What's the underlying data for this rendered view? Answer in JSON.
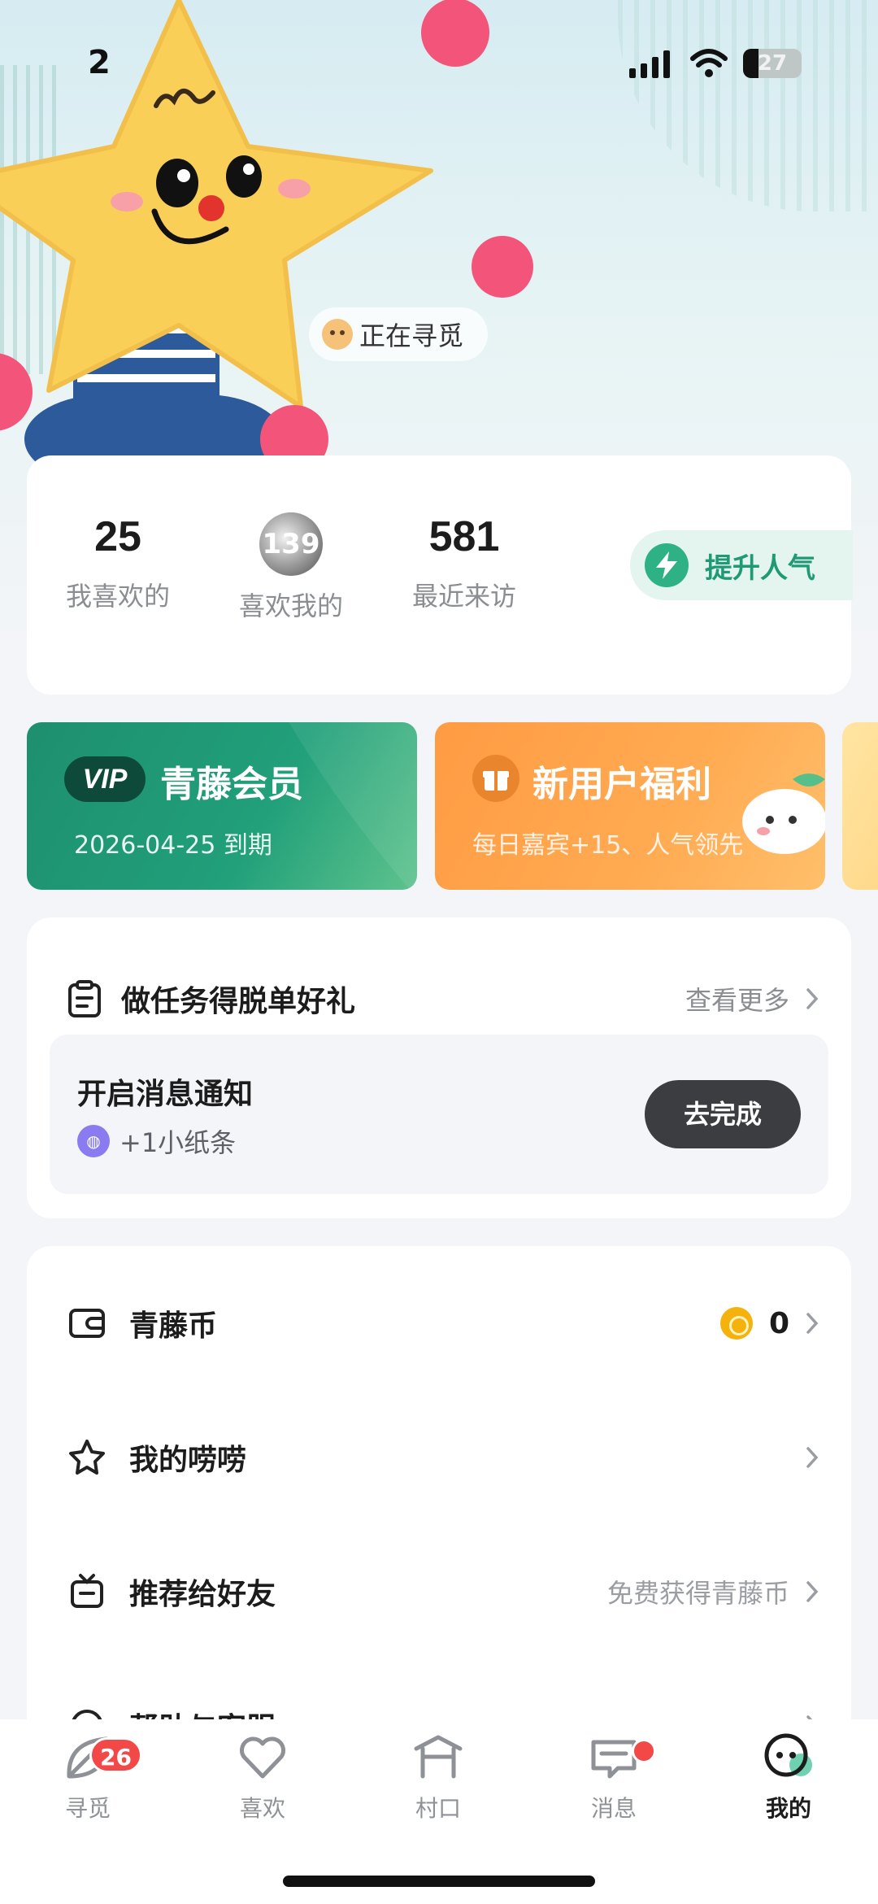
{
  "status_bar": {
    "time": "2",
    "battery": "27"
  },
  "profile": {
    "status_chip": "正在寻觅",
    "stats": [
      {
        "value": "25",
        "label": "我喜欢的"
      },
      {
        "value": "139",
        "label": "喜欢我的"
      },
      {
        "value": "581",
        "label": "最近来访"
      }
    ],
    "boost_label": "提升人气"
  },
  "promos": {
    "vip": {
      "logo": "VIP",
      "title": "青藤会员",
      "subtitle": "2026-04-25 到期"
    },
    "new_user": {
      "title": "新用户福利",
      "subtitle": "每日嘉宾+15、人气领先"
    }
  },
  "tasks": {
    "title": "做任务得脱单好礼",
    "more_label": "查看更多",
    "item": {
      "title": "开启消息通知",
      "reward": "+1小纸条",
      "action": "去完成"
    }
  },
  "menu": {
    "items": [
      {
        "label": "青藤币",
        "right_text": "",
        "count": "0"
      },
      {
        "label": "我的唠唠",
        "right_text": ""
      },
      {
        "label": "推荐给好友",
        "right_text": "免费获得青藤币"
      },
      {
        "label": "帮助与客服",
        "right_text": ""
      }
    ]
  },
  "tab_bar": {
    "tabs": [
      {
        "label": "寻觅",
        "badge": "26"
      },
      {
        "label": "喜欢"
      },
      {
        "label": "村口"
      },
      {
        "label": "消息"
      },
      {
        "label": "我的"
      }
    ],
    "active": "我的"
  },
  "colors": {
    "accent_green": "#21a07a",
    "orange": "#ff9b43",
    "badge_red": "#f24848"
  }
}
